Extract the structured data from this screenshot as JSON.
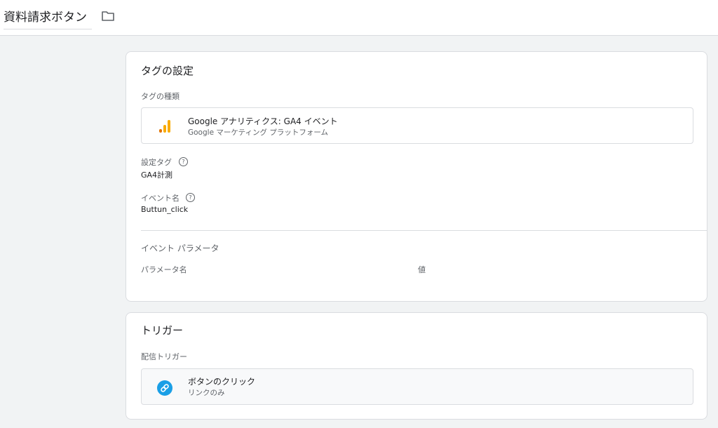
{
  "header": {
    "tag_name": "資料請求ボタン",
    "folder_icon": "folder-icon"
  },
  "tag_config": {
    "title": "タグの設定",
    "tag_type_label": "タグの種類",
    "tag_type": {
      "name": "Google アナリティクス: GA4 イベント",
      "platform": "Google マーケティング プラットフォーム",
      "icon": "analytics-icon",
      "icon_colors": [
        "#f9ab00",
        "#e37400"
      ]
    },
    "config_tag_label": "設定タグ",
    "config_tag_value": "GA4計測",
    "event_name_label": "イベント名",
    "event_name_value": "Buttun_click",
    "event_params_label": "イベント パラメータ",
    "param_name_header": "パラメータ名",
    "value_header": "値"
  },
  "trigger": {
    "title": "トリガー",
    "firing_label": "配信トリガー",
    "item": {
      "name": "ボタンのクリック",
      "type": "リンクのみ",
      "icon": "link-icon",
      "icon_color": "#1a9fe6"
    }
  }
}
